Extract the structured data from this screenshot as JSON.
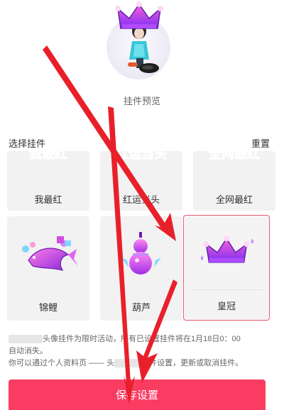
{
  "preview": {
    "label": "挂件预览",
    "avatar_icon": "avatar-with-crown"
  },
  "section": {
    "title": "选择挂件",
    "reset_label": "重置"
  },
  "pendants": [
    {
      "name": "我最红",
      "art_text": "我最红",
      "icon": "text-badge"
    },
    {
      "name": "红运当头",
      "art_text": "红运当头",
      "icon": "text-badge"
    },
    {
      "name": "全网最红",
      "art_text": "全网最红",
      "icon": "text-badge"
    },
    {
      "name": "锦鲤",
      "icon": "koi-fish-icon"
    },
    {
      "name": "葫芦",
      "icon": "gourd-icon"
    },
    {
      "name": "皇冠",
      "icon": "crown-icon",
      "selected": true
    }
  ],
  "notice": {
    "line1": "头像挂件为限时活动，所有已设置挂件将在1月18日0：00",
    "line2": "自动消失。",
    "line3a": "你可以通过个人资料页 —— 头",
    "line3b": "挂件设置，更新或取消挂件。"
  },
  "save_button": {
    "label": "保存设置"
  },
  "colors": {
    "accent": "#fb3c62",
    "selected_border": "#f05a74",
    "arrow": "#e8202a"
  }
}
